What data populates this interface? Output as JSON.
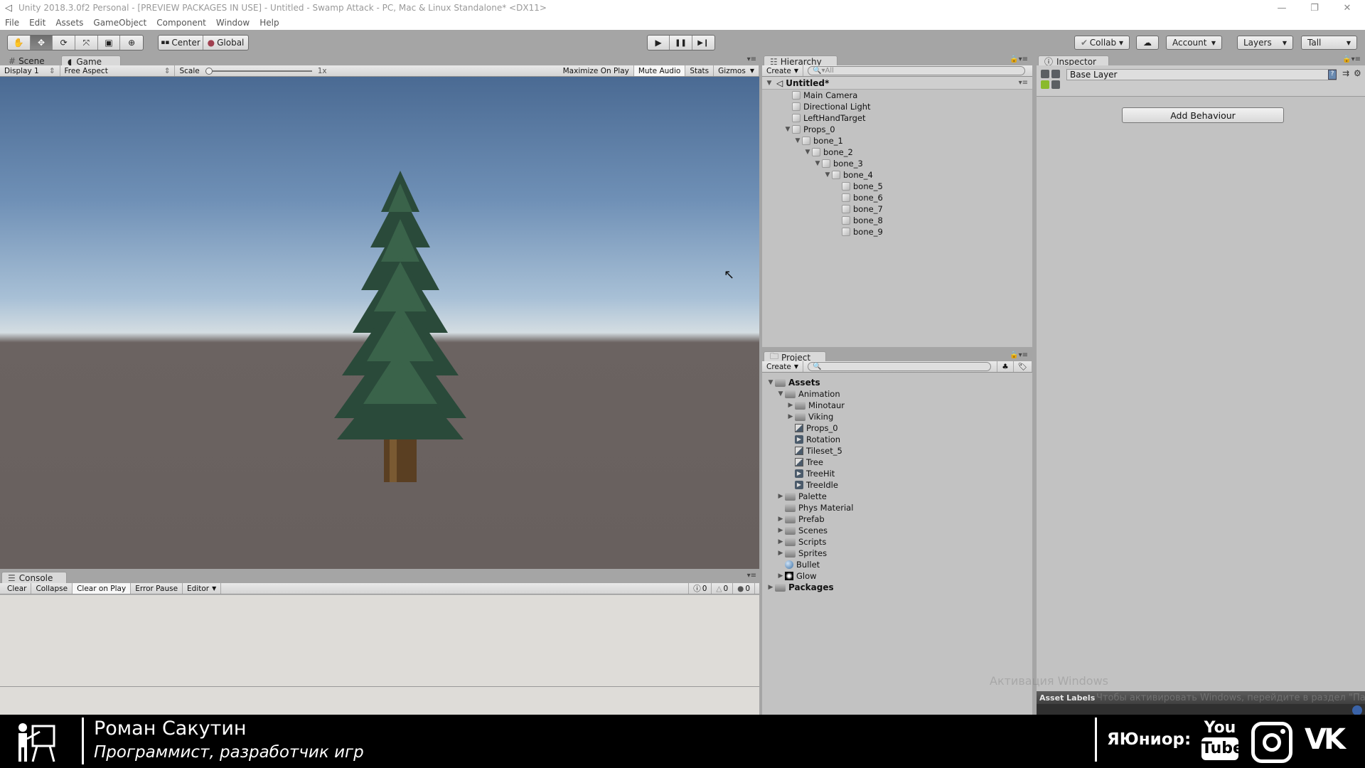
{
  "window": {
    "title": "Unity 2018.3.0f2 Personal - [PREVIEW PACKAGES IN USE] - Untitled - Swamp Attack - PC, Mac & Linux Standalone* <DX11>",
    "minimize": "—",
    "restore": "❐",
    "close": "✕"
  },
  "menu": [
    "File",
    "Edit",
    "Assets",
    "GameObject",
    "Component",
    "Window",
    "Help"
  ],
  "toolbar": {
    "tools": [
      {
        "name": "hand-tool",
        "glyph": "✋"
      },
      {
        "name": "move-tool",
        "glyph": "✥"
      },
      {
        "name": "rotate-tool",
        "glyph": "⟳"
      },
      {
        "name": "scale-tool",
        "glyph": "⤧"
      },
      {
        "name": "rect-tool",
        "glyph": "▣"
      },
      {
        "name": "transform-tool",
        "glyph": "⊕"
      }
    ],
    "pivot_center": "Center",
    "pivot_global": "Global",
    "play": "▶",
    "pause": "❚❚",
    "step": "▶❙",
    "collab": "Collab ▾",
    "cloud": "☁",
    "account": "Account",
    "layers": "Layers",
    "layout": "Tall"
  },
  "game_panel": {
    "tabs": [
      {
        "label": "Scene",
        "icon": "#"
      },
      {
        "label": "Game",
        "icon": "◖"
      }
    ],
    "display": "Display 1",
    "aspect": "Free Aspect",
    "scale_label": "Scale",
    "scale_value": "1x",
    "scale_slider": 0.0,
    "buttons": [
      "Maximize On Play",
      "Mute Audio",
      "Stats",
      "Gizmos"
    ],
    "active_buttons": [
      "Mute Audio"
    ]
  },
  "console": {
    "tab": "Console",
    "buttons": [
      "Clear",
      "Collapse",
      "Clear on Play",
      "Error Pause",
      "Editor"
    ],
    "active_buttons": [
      "Clear on Play"
    ],
    "info_count": "0",
    "warning_count": "0",
    "error_count": "0"
  },
  "hierarchy": {
    "tab": "Hierarchy",
    "create": "Create",
    "search_placeholder": "All",
    "scene": "Untitled*",
    "items": [
      {
        "label": "Main Camera",
        "depth": 0,
        "arrow": ""
      },
      {
        "label": "Directional Light",
        "depth": 0,
        "arrow": ""
      },
      {
        "label": "LeftHandTarget",
        "depth": 0,
        "arrow": ""
      },
      {
        "label": "Props_0",
        "depth": 0,
        "arrow": "▼"
      },
      {
        "label": "bone_1",
        "depth": 1,
        "arrow": "▼"
      },
      {
        "label": "bone_2",
        "depth": 2,
        "arrow": "▼"
      },
      {
        "label": "bone_3",
        "depth": 3,
        "arrow": "▼"
      },
      {
        "label": "bone_4",
        "depth": 4,
        "arrow": "▼"
      },
      {
        "label": "bone_5",
        "depth": 5,
        "arrow": ""
      },
      {
        "label": "bone_6",
        "depth": 5,
        "arrow": ""
      },
      {
        "label": "bone_7",
        "depth": 5,
        "arrow": ""
      },
      {
        "label": "bone_8",
        "depth": 5,
        "arrow": ""
      },
      {
        "label": "bone_9",
        "depth": 5,
        "arrow": ""
      }
    ]
  },
  "project": {
    "tab": "Project",
    "create": "Create",
    "search_placeholder": "",
    "items": [
      {
        "label": "Assets",
        "depth": 0,
        "arrow": "▼",
        "icon": "folder",
        "bold": true
      },
      {
        "label": "Animation",
        "depth": 1,
        "arrow": "▼",
        "icon": "folder"
      },
      {
        "label": "Minotaur",
        "depth": 2,
        "arrow": "▶",
        "icon": "folder"
      },
      {
        "label": "Viking",
        "depth": 2,
        "arrow": "▶",
        "icon": "folder"
      },
      {
        "label": "Props_0",
        "depth": 2,
        "arrow": "",
        "icon": "sprite"
      },
      {
        "label": "Rotation",
        "depth": 2,
        "arrow": "",
        "icon": "anim"
      },
      {
        "label": "Tileset_5",
        "depth": 2,
        "arrow": "",
        "icon": "sprite"
      },
      {
        "label": "Tree",
        "depth": 2,
        "arrow": "",
        "icon": "sprite"
      },
      {
        "label": "TreeHit",
        "depth": 2,
        "arrow": "",
        "icon": "anim"
      },
      {
        "label": "TreeIdle",
        "depth": 2,
        "arrow": "",
        "icon": "anim"
      },
      {
        "label": "Palette",
        "depth": 1,
        "arrow": "▶",
        "icon": "folder"
      },
      {
        "label": "Phys Material",
        "depth": 1,
        "arrow": "",
        "icon": "folder"
      },
      {
        "label": "Prefab",
        "depth": 1,
        "arrow": "▶",
        "icon": "folder"
      },
      {
        "label": "Scenes",
        "depth": 1,
        "arrow": "▶",
        "icon": "folder"
      },
      {
        "label": "Scripts",
        "depth": 1,
        "arrow": "▶",
        "icon": "folder"
      },
      {
        "label": "Sprites",
        "depth": 1,
        "arrow": "▶",
        "icon": "folder"
      },
      {
        "label": "Bullet",
        "depth": 1,
        "arrow": "",
        "icon": "sphere"
      },
      {
        "label": "Glow",
        "depth": 1,
        "arrow": "▶",
        "icon": "glow"
      },
      {
        "label": "Packages",
        "depth": 0,
        "arrow": "▶",
        "icon": "folder",
        "bold": true
      }
    ]
  },
  "inspector": {
    "tab": "Inspector",
    "layer_name": "Base Layer",
    "add_behaviour": "Add Behaviour",
    "asset_labels": "Asset Labels"
  },
  "watermark": {
    "line1": "Активация Windows",
    "line2": "Чтобы активировать Windows, перейдите в раздел \"Параметры\"."
  },
  "footer": {
    "name": "Роман Сакутин",
    "role": "Программист, разработчик игр",
    "brand": "ЯЮниор:",
    "youtube_top": "You",
    "youtube_bottom": "Tube",
    "vk": "VK"
  }
}
